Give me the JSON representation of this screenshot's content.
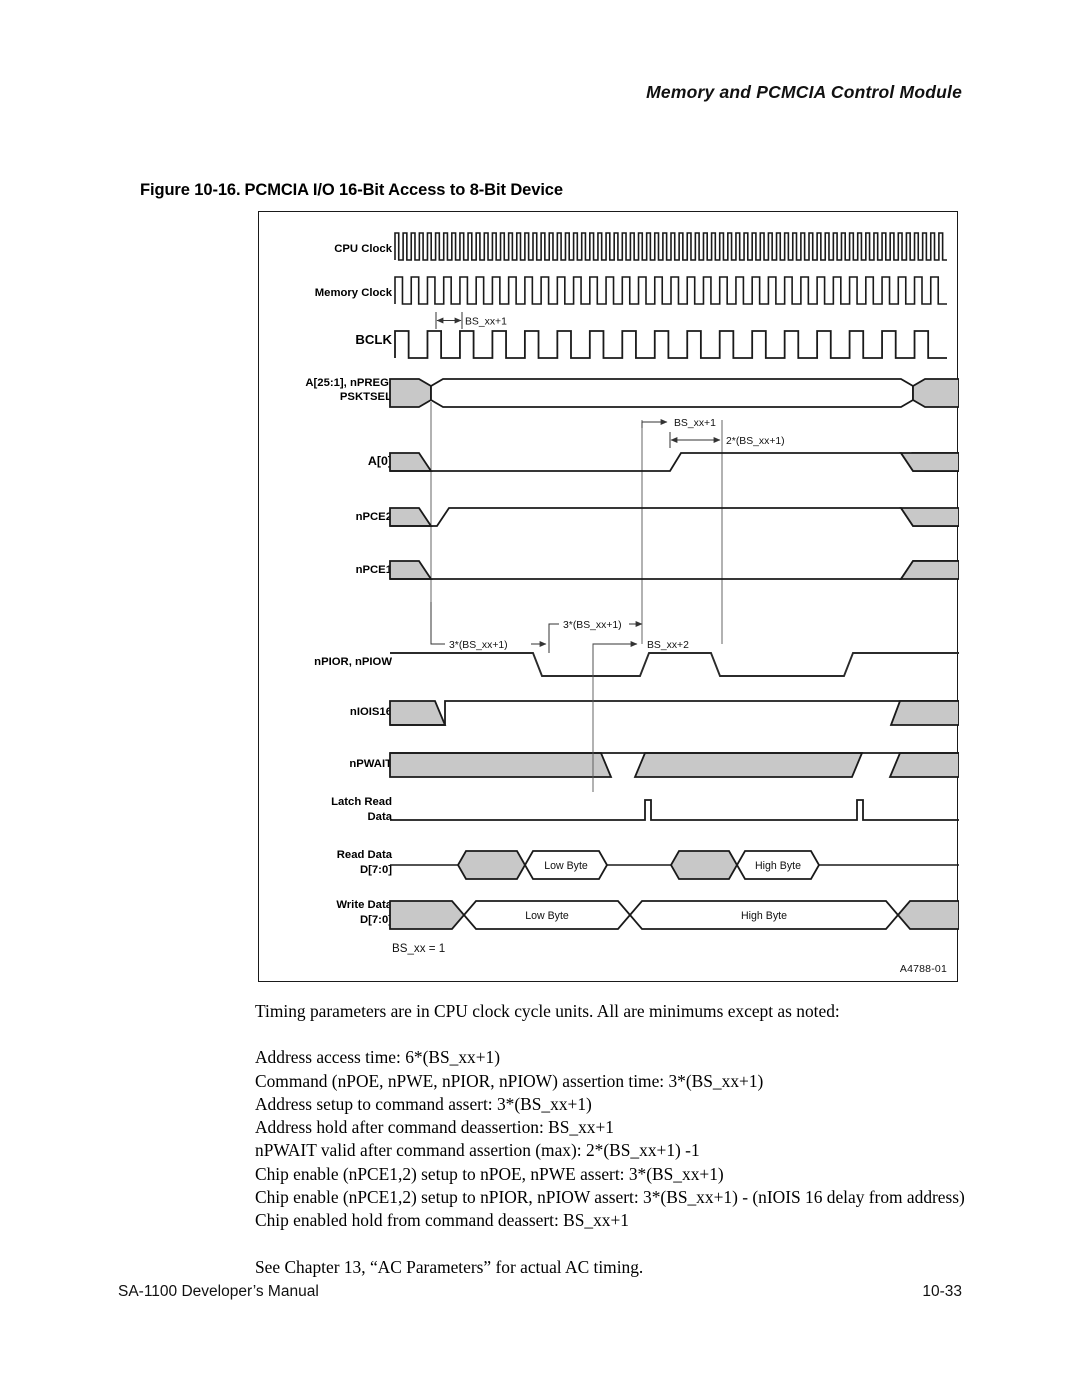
{
  "header": {
    "running_head": "Memory and PCMCIA Control Module"
  },
  "figure": {
    "number": "Figure 10-16.",
    "title": "PCMCIA I/O 16-Bit Access to 8-Bit Device",
    "art_id": "A4788-01",
    "footnote": "BS_xx = 1",
    "signals": [
      {
        "id": "cpu-clock",
        "label": "CPU Clock",
        "label_line2": ""
      },
      {
        "id": "memory-clock",
        "label": "Memory Clock",
        "label_line2": ""
      },
      {
        "id": "bclk",
        "label": "BCLK",
        "label_line2": ""
      },
      {
        "id": "addr-bus",
        "label": "A[25:1], nPREG,",
        "label_line2": "PSKTSEL"
      },
      {
        "id": "a0",
        "label": "A[0]",
        "label_line2": ""
      },
      {
        "id": "npce2",
        "label": "nPCE2",
        "label_line2": ""
      },
      {
        "id": "npce1",
        "label": "nPCE1",
        "label_line2": ""
      },
      {
        "id": "npior-npiow",
        "label": "nPIOR, nPIOW",
        "label_line2": ""
      },
      {
        "id": "niois16",
        "label": "nIOIS16",
        "label_line2": ""
      },
      {
        "id": "npwait",
        "label": "nPWAIT",
        "label_line2": ""
      },
      {
        "id": "latch-read",
        "label": "Latch Read",
        "label_line2": "Data"
      },
      {
        "id": "read-data",
        "label": "Read Data",
        "label_line2": "D[7:0]"
      },
      {
        "id": "write-data",
        "label": "Write Data",
        "label_line2": "D[7:0]"
      }
    ],
    "annotations": {
      "bclk_period": "BS_xx+1",
      "a0_bs1": "BS_xx+1",
      "a0_2bs1": "2*(BS_xx+1)",
      "cmd_3bs1_a": "3*(BS_xx+1)",
      "cmd_3bs1_b": "3*(BS_xx+1)",
      "cmd_bs2": "BS_xx+2"
    },
    "bus_values": {
      "read_low": "Low Byte",
      "read_high": "High Byte",
      "write_low": "Low Byte",
      "write_high": "High Byte"
    },
    "colors": {
      "bus_fill": "#c8c8c8",
      "line": "#1a1a1a",
      "annotation_line": "#333333"
    }
  },
  "body": {
    "intro": "Timing parameters are in CPU clock cycle units. All are minimums except as noted:",
    "parameters": [
      "Address access time: 6*(BS_xx+1)",
      "Command (nPOE, nPWE, nPIOR, nPIOW) assertion time: 3*(BS_xx+1)",
      "Address setup to command assert: 3*(BS_xx+1)",
      "Address hold after command deassertion: BS_xx+1",
      "nPWAIT valid after command assertion (max): 2*(BS_xx+1) -1",
      "Chip enable (nPCE1,2) setup to nPOE, nPWE assert: 3*(BS_xx+1)",
      "Chip enable (nPCE1,2) setup to nPIOR, nPIOW assert: 3*(BS_xx+1) - (nIOIS 16 delay from address)",
      "Chip enabled hold from command deassert:  BS_xx+1"
    ],
    "see_also": "See Chapter 13, “AC Parameters” for actual AC timing."
  },
  "footer": {
    "manual": "SA-1100 Developer’s Manual",
    "page": "10-33"
  }
}
